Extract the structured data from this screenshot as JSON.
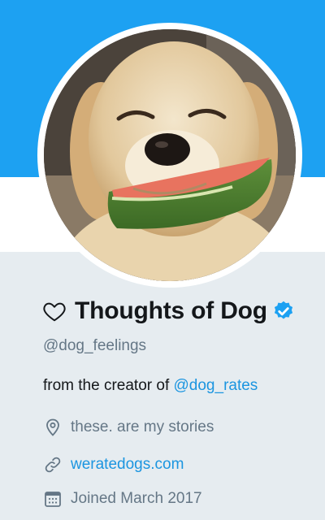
{
  "profile": {
    "display_name": "Thoughts of Dog",
    "handle": "@dog_feelings",
    "bio_prefix": "from the creator of ",
    "bio_mention": "@dog_rates",
    "location": "these. are my stories",
    "website": "weratedogs.com",
    "joined": "Joined March 2017",
    "verified": true
  },
  "icons": {
    "name_prefix": "heart-outline-icon",
    "verified": "verified-badge-icon",
    "location": "location-pin-icon",
    "link": "link-icon",
    "joined": "calendar-icon"
  },
  "colors": {
    "banner": "#1da1f2",
    "background": "#e6ecf0",
    "link": "#1b95e0",
    "secondary_text": "#657786",
    "primary_text": "#14171a"
  }
}
